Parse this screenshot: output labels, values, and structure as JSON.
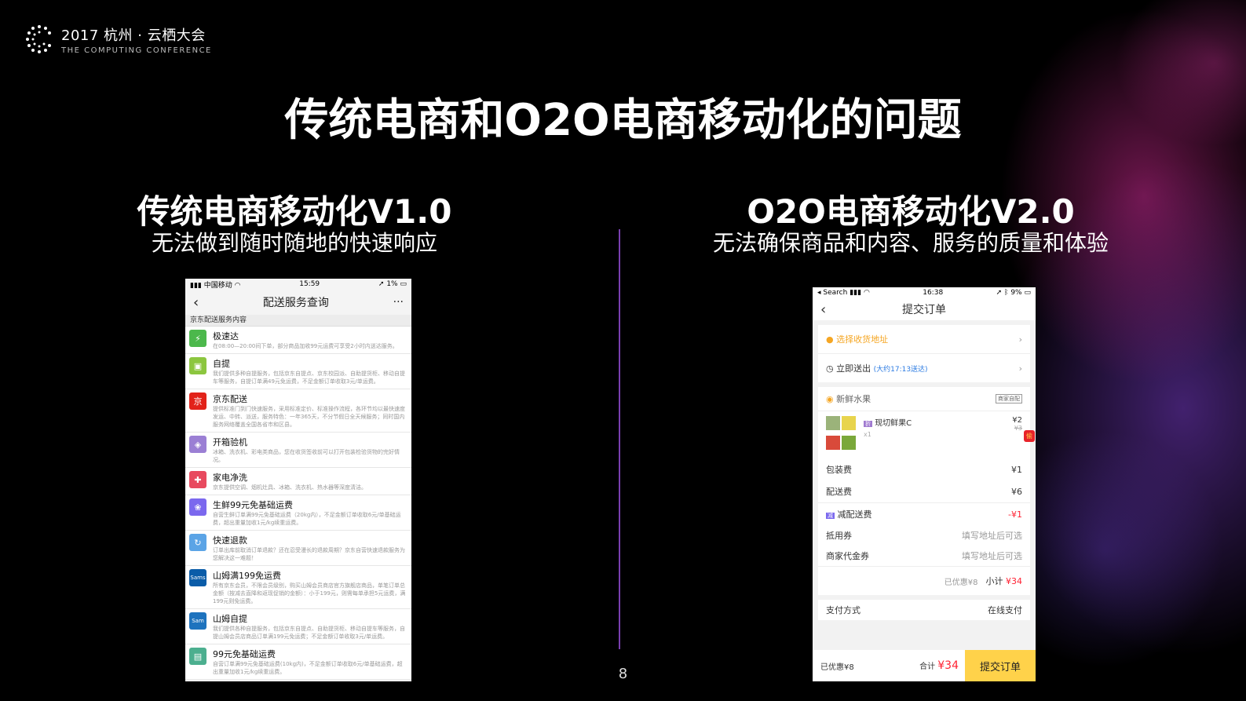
{
  "header": {
    "logo_main": "2017 杭州 · 云栖大会",
    "logo_sub": "THE COMPUTING CONFERENCE"
  },
  "title": "传统电商和O2O电商移动化的问题",
  "left": {
    "heading": "传统电商移动化V1.0",
    "subheading": "无法做到随时随地的快速响应",
    "phone": {
      "carrier": "中国移动",
      "time": "15:59",
      "battery": "1%",
      "nav_title": "配送服务查询",
      "more": "···",
      "section": "京东配送服务内容",
      "items": [
        {
          "title": "极速达",
          "desc": "在08:00—20:00间下单，部分商品加收99元运费可享受2小时内送达服务。",
          "color": "#4cb84c",
          "icon": "⚡"
        },
        {
          "title": "自提",
          "desc": "我们提供多种自提服务，包括京东自提点、京东校园派、自助提货柜、移动自提车等服务，自提订单满49元免运费，不足金额订单收取3元/单运费。",
          "color": "#8cc63f",
          "icon": "▣"
        },
        {
          "title": "京东配送",
          "desc": "提供标准门到门快速服务，采用标准定价、标准操作流程，各环节均以最快速度发运、中转、派送，服务特色：一年365天，不分节假日全天候服务；同时国内服务网络覆盖全国各省市和区县。",
          "color": "#e2231a",
          "icon": "京"
        },
        {
          "title": "开箱验机",
          "desc": "冰箱、洗衣机、彩电类商品，您在收货签收前可以打开包装检验货物的完好情况。",
          "color": "#9b7fd4",
          "icon": "◈"
        },
        {
          "title": "家电净洗",
          "desc": "京东提供空调、烟机灶具、冰箱、洗衣机、热水器等深度清洁。",
          "color": "#e84a5f",
          "icon": "✚"
        },
        {
          "title": "生鲜99元免基础运费",
          "desc": "自营生鲜订单满99元免基础运费（20kg内），不足金额订单收取6元/单基础运费，超出重量加收1元/kg续重运费。",
          "color": "#7b68ee",
          "icon": "❀"
        },
        {
          "title": "快速退款",
          "desc": "订单出库前取消订单退款？还在忍受漫长的退款周期？京东自营快速退款服务为您解决这一难题！",
          "color": "#5ba4e6",
          "icon": "↻"
        },
        {
          "title": "山姆满199免运费",
          "desc": "所有京东会员，不限会员级别，购买山姆会员商店官方旗舰店商品，单笔订单总金额（按减去直降和返现促销的金额）：小于199元，则需每单承担5元运费，满199元则免运费。",
          "color": "#0a5ca8",
          "icon": "Sams"
        },
        {
          "title": "山姆自提",
          "desc": "我们提供各种自提服务，包括京东自提点、自助提货柜、移动自提车等服务，自提山姆会员店商品订单满199元免运费；不足金额订单收取3元/单运费。",
          "color": "#1e73be",
          "icon": "Sam"
        },
        {
          "title": "99元免基础运费",
          "desc": "自营订单满99元免基础运费(10kg内)，不足金额订单收取6元/单基础运费，超出重量加收1元/kg续重运费。",
          "color": "#4caf8f",
          "icon": "▤"
        }
      ]
    }
  },
  "right": {
    "heading": "O2O电商移动化V2.0",
    "subheading": "无法确保商品和内容、服务的质量和体验",
    "phone": {
      "back_app": "Search",
      "time": "16:38",
      "battery": "9%",
      "nav_title": "提交订单",
      "address": "选择收货地址",
      "delivery": "立即送出",
      "delivery_eta": "(大约17:13送达)",
      "shop": "新鲜水果",
      "shop_badge": "商家自配",
      "product_tag": "折",
      "product": "现切鲜果C",
      "product_price": "¥2",
      "product_orig": "¥3",
      "product_qty": "x1",
      "promo_tag": "偷",
      "pack_label": "包装费",
      "pack_value": "¥1",
      "ship_label": "配送费",
      "ship_value": "¥6",
      "reduce_tag": "减",
      "reduce_label": "减配送费",
      "reduce_value": "-¥1",
      "coupon_label": "抵用券",
      "coupon_value": "填写地址后可选",
      "voucher_label": "商家代金券",
      "voucher_value": "填写地址后可选",
      "discounted": "已优惠¥8",
      "subtotal_label": "小计",
      "subtotal_value": "¥34",
      "pay_label": "支付方式",
      "pay_value": "在线支付",
      "bottom_discount": "已优惠¥8",
      "total_label": "合计",
      "total_value": "¥34",
      "submit": "提交订单"
    }
  },
  "page_number": "8"
}
